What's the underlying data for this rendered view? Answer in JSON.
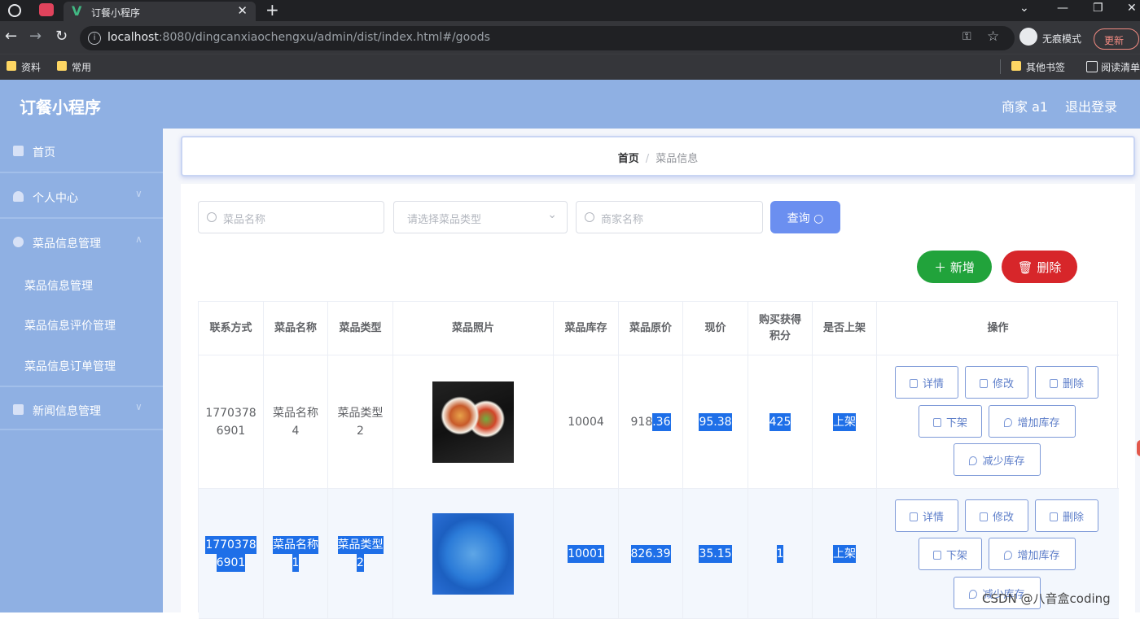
{
  "browser": {
    "tab_title": "订餐小程序",
    "tab_close": "✕",
    "new_tab": "+",
    "url_host": "localhost",
    "url_rest": ":8080/dingcanxiaochengxu/admin/dist/index.html#/goods",
    "incognito_label": "无痕模式",
    "update_label": "更新",
    "bookmarks": [
      "资料",
      "常用",
      "其他书签",
      "阅读清单"
    ],
    "window_controls": [
      "⌄",
      "—",
      "❐",
      "✕"
    ]
  },
  "app": {
    "title": "订餐小程序",
    "user": "商家 a1",
    "logout": "退出登录"
  },
  "sidebar": {
    "items": [
      {
        "label": "首页",
        "icon": "home-icon"
      },
      {
        "label": "个人中心",
        "icon": "user-icon"
      },
      {
        "label": "菜品信息管理",
        "icon": "compass-icon"
      },
      {
        "label": "新闻信息管理",
        "icon": "news-icon"
      }
    ],
    "sub_items": [
      "菜品信息管理",
      "菜品信息评价管理",
      "菜品信息订单管理"
    ]
  },
  "breadcrumb": {
    "home": "首页",
    "separator": "/",
    "current": "菜品信息"
  },
  "search": {
    "name_placeholder": "菜品名称",
    "type_placeholder": "请选择菜品类型",
    "merchant_placeholder": "商家名称",
    "query_label": "查询"
  },
  "actions": {
    "add_label": "新增",
    "delete_label": "删除"
  },
  "table": {
    "headers": [
      "联系方式",
      "菜品名称",
      "菜品类型",
      "菜品照片",
      "菜品库存",
      "菜品原价",
      "现价",
      "购买获得积分",
      "是否上架",
      "操作"
    ],
    "header_lines": {
      "points_line1": "购买获得",
      "points_line2": "积分"
    },
    "rows": [
      {
        "phone_1": "1770378",
        "phone_2": "6901",
        "name_1": "菜品名称",
        "name_2": "4",
        "type_1": "菜品类型",
        "type_2": "2",
        "stock": "10004",
        "price_a": "918",
        "price_b": ".36",
        "current": "95.38",
        "points": "425",
        "on_shelf": "上架"
      },
      {
        "phone_1": "1770378",
        "phone_2": "6901",
        "name_1": "菜品名称",
        "name_2": "1",
        "type_1": "菜品类型",
        "type_2": "2",
        "stock": "10001",
        "price": "826.39",
        "current": "35.15",
        "points": "1",
        "on_shelf": "上架"
      }
    ],
    "ops": [
      "详情",
      "修改",
      "删除",
      "下架",
      "增加库存",
      "减少库存"
    ]
  },
  "watermark": "CSDN @八音盒coding",
  "colors": {
    "sidebar": "#8fb0e3",
    "primary": "#6b8ff0",
    "success": "#21a33b",
    "danger": "#d7262a",
    "selection": "#1e6fe8"
  }
}
